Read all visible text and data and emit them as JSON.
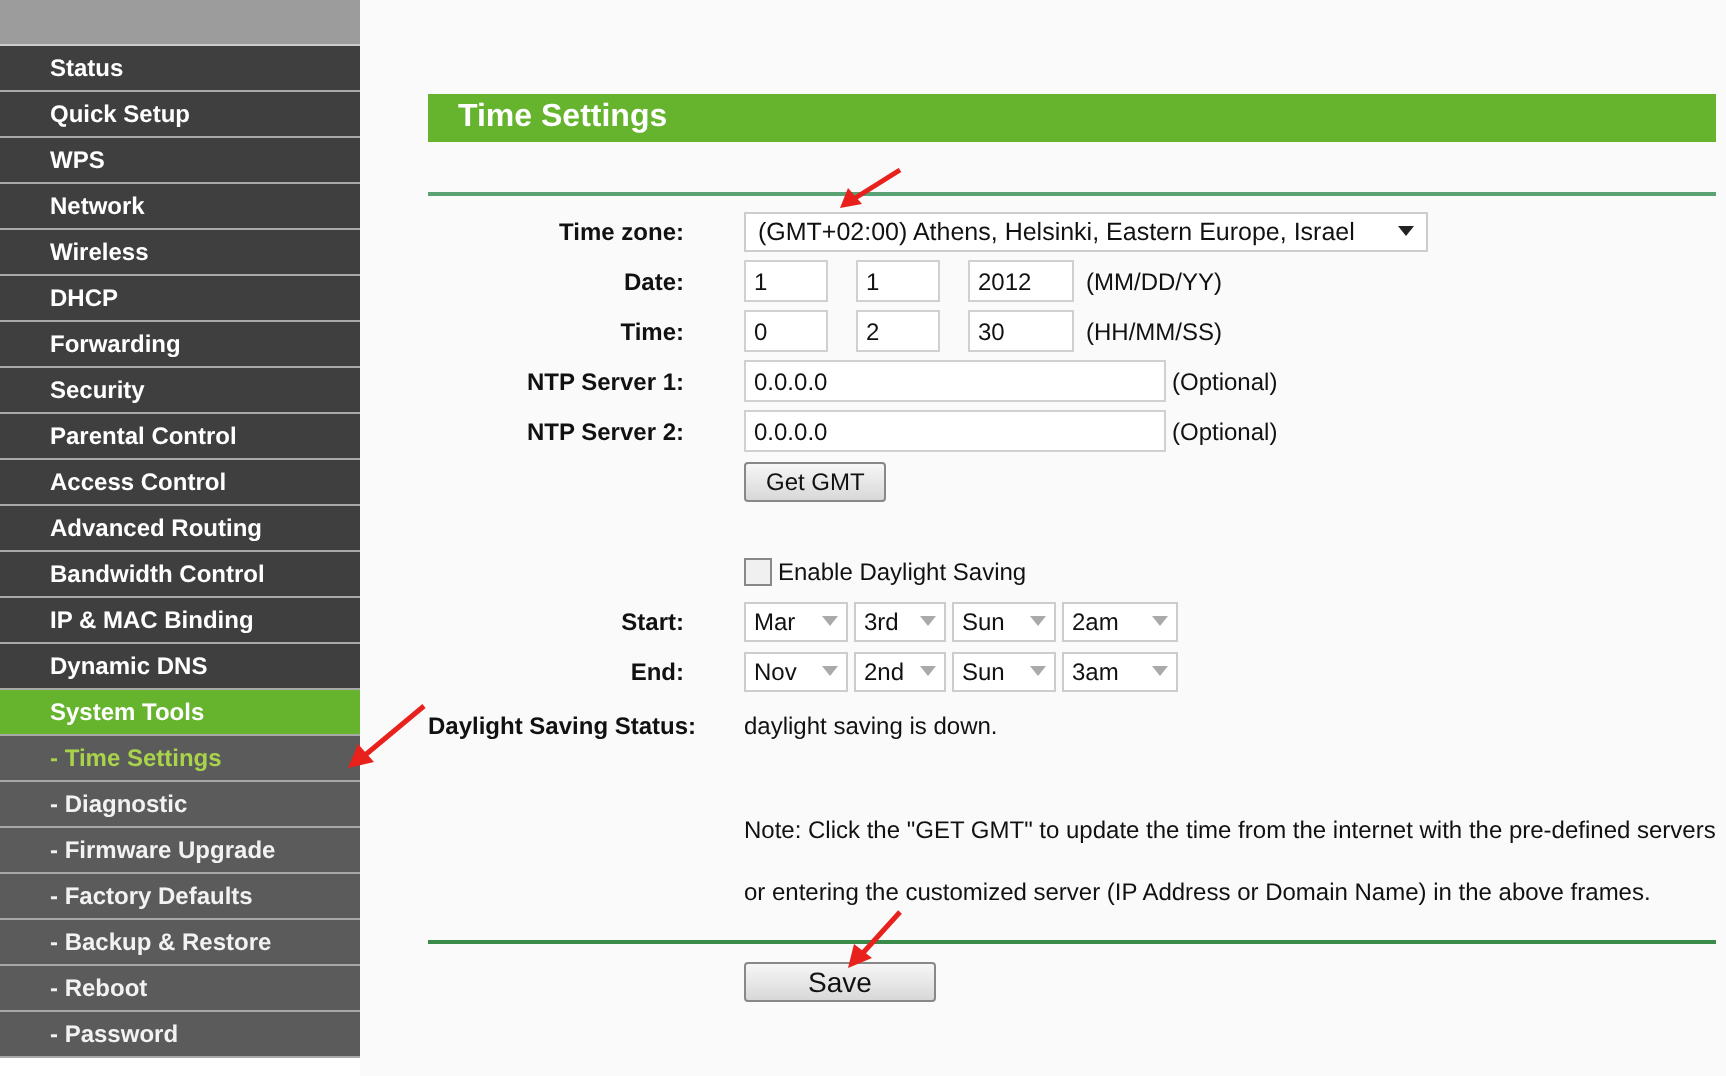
{
  "sidebar": {
    "items": [
      {
        "label": "Status",
        "kind": "main",
        "selected": false
      },
      {
        "label": "Quick Setup",
        "kind": "main",
        "selected": false
      },
      {
        "label": "WPS",
        "kind": "main",
        "selected": false
      },
      {
        "label": "Network",
        "kind": "main",
        "selected": false
      },
      {
        "label": "Wireless",
        "kind": "main",
        "selected": false
      },
      {
        "label": "DHCP",
        "kind": "main",
        "selected": false
      },
      {
        "label": "Forwarding",
        "kind": "main",
        "selected": false
      },
      {
        "label": "Security",
        "kind": "main",
        "selected": false
      },
      {
        "label": "Parental Control",
        "kind": "main",
        "selected": false
      },
      {
        "label": "Access Control",
        "kind": "main",
        "selected": false
      },
      {
        "label": "Advanced Routing",
        "kind": "main",
        "selected": false
      },
      {
        "label": "Bandwidth Control",
        "kind": "main",
        "selected": false
      },
      {
        "label": "IP & MAC Binding",
        "kind": "main",
        "selected": false
      },
      {
        "label": "Dynamic DNS",
        "kind": "main",
        "selected": false
      },
      {
        "label": "System Tools",
        "kind": "main",
        "selected": true
      },
      {
        "label": "- Time Settings",
        "kind": "sub",
        "selected": true
      },
      {
        "label": "- Diagnostic",
        "kind": "sub",
        "selected": false
      },
      {
        "label": "- Firmware Upgrade",
        "kind": "sub",
        "selected": false
      },
      {
        "label": "- Factory Defaults",
        "kind": "sub",
        "selected": false
      },
      {
        "label": "- Backup & Restore",
        "kind": "sub",
        "selected": false
      },
      {
        "label": "- Reboot",
        "kind": "sub",
        "selected": false
      },
      {
        "label": "- Password",
        "kind": "sub",
        "selected": false
      }
    ]
  },
  "section_title": "Time Settings",
  "time_zone": {
    "label": "Time zone:",
    "value": "(GMT+02:00) Athens, Helsinki, Eastern Europe, Israel"
  },
  "date": {
    "label": "Date:",
    "values": [
      "1",
      "1",
      "2012"
    ],
    "hint": "(MM/DD/YY)"
  },
  "time": {
    "label": "Time:",
    "values": [
      "0",
      "2",
      "30"
    ],
    "hint": "(HH/MM/SS)"
  },
  "ntp_servers": [
    {
      "label": "NTP Server 1:",
      "value": "0.0.0.0",
      "hint": "(Optional)"
    },
    {
      "label": "NTP Server 2:",
      "value": "0.0.0.0",
      "hint": "(Optional)"
    }
  ],
  "get_gmt_button": "Get GMT",
  "daylight_saving": {
    "label": "Enable Daylight Saving",
    "checked": false
  },
  "dst_rows": [
    {
      "label": "Start:",
      "values": [
        "Mar",
        "3rd",
        "Sun",
        "2am"
      ]
    },
    {
      "label": "End:",
      "values": [
        "Nov",
        "2nd",
        "Sun",
        "3am"
      ]
    }
  ],
  "dst_status": {
    "label": "Daylight Saving Status:",
    "value": "daylight saving is down."
  },
  "note": [
    "Note: Click the \"GET GMT\" to update the time from the internet with the pre-defined servers",
    "or entering the customized server (IP Address or Domain Name) in the above frames."
  ],
  "save_button": "Save"
}
